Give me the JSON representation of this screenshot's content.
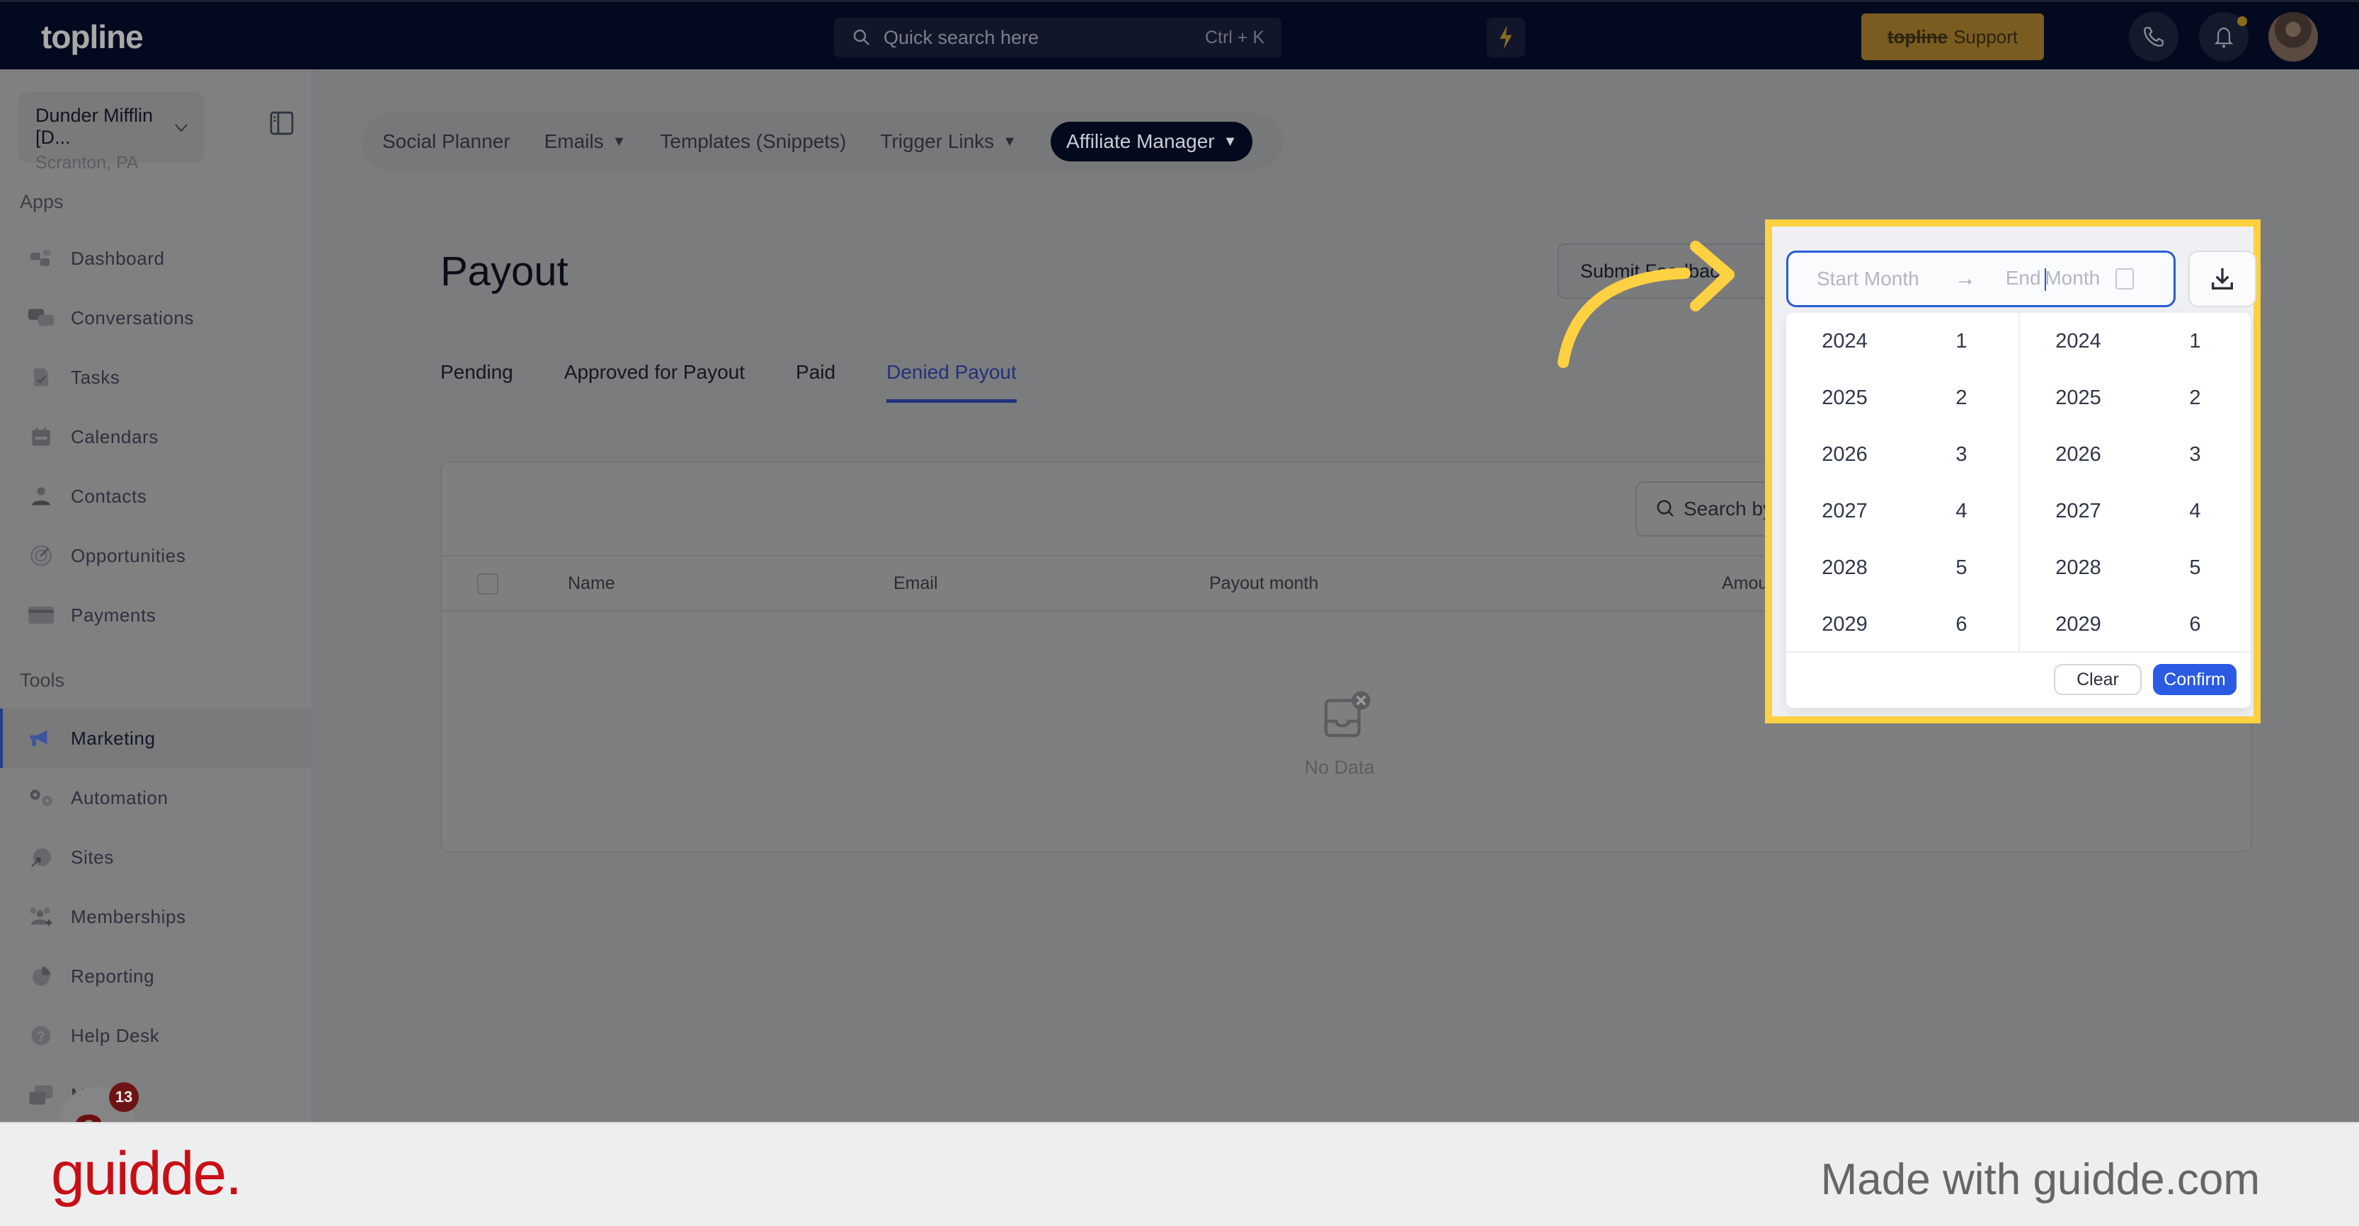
{
  "header": {
    "logo": "topline",
    "search_placeholder": "Quick search here",
    "search_shortcut": "Ctrl + K",
    "support_brand": "topline",
    "support_label": "Support"
  },
  "sidebar": {
    "location_name": "Dunder Mifflin [D...",
    "location_sub": "Scranton, PA",
    "apps_label": "Apps",
    "apps": [
      {
        "label": "Dashboard",
        "icon": "dashboard-icon"
      },
      {
        "label": "Conversations",
        "icon": "conversations-icon"
      },
      {
        "label": "Tasks",
        "icon": "tasks-icon"
      },
      {
        "label": "Calendars",
        "icon": "calendar-icon"
      },
      {
        "label": "Contacts",
        "icon": "contacts-icon"
      },
      {
        "label": "Opportunities",
        "icon": "target-icon"
      },
      {
        "label": "Payments",
        "icon": "credit-card-icon"
      }
    ],
    "tools_label": "Tools",
    "tools": [
      {
        "label": "Marketing",
        "icon": "megaphone-icon",
        "active": true
      },
      {
        "label": "Automation",
        "icon": "gears-icon"
      },
      {
        "label": "Sites",
        "icon": "globe-cursor-icon"
      },
      {
        "label": "Memberships",
        "icon": "users-plus-icon"
      },
      {
        "label": "Reporting",
        "icon": "pie-chart-icon"
      },
      {
        "label": "Help Desk",
        "icon": "help-icon"
      },
      {
        "label": "Mailgun",
        "icon": "mail-icon"
      }
    ],
    "notification_count": "13"
  },
  "marketing_nav": {
    "items": [
      {
        "label": "Social Planner",
        "dropdown": false
      },
      {
        "label": "Emails",
        "dropdown": true
      },
      {
        "label": "Templates (Snippets)",
        "dropdown": false
      },
      {
        "label": "Trigger Links",
        "dropdown": true
      },
      {
        "label": "Affiliate Manager",
        "dropdown": true,
        "active": true
      }
    ]
  },
  "page": {
    "title": "Payout",
    "feedback_button": "Submit Feedback",
    "tabs": [
      {
        "label": "Pending"
      },
      {
        "label": "Approved for Payout"
      },
      {
        "label": "Paid"
      },
      {
        "label": "Denied Payout",
        "active": true
      }
    ],
    "search_placeholder": "Search by",
    "columns": [
      "Name",
      "Email",
      "Payout month",
      "Amount"
    ],
    "empty_text": "No Data"
  },
  "month_picker": {
    "start_placeholder": "Start Month",
    "end_placeholder_a": "End ",
    "end_placeholder_b": "Month",
    "start": {
      "years": [
        "2024",
        "2025",
        "2026",
        "2027",
        "2028",
        "2029"
      ],
      "months": [
        "1",
        "2",
        "3",
        "4",
        "5",
        "6"
      ]
    },
    "end": {
      "years": [
        "2024",
        "2025",
        "2026",
        "2027",
        "2028",
        "2029"
      ],
      "months": [
        "1",
        "2",
        "3",
        "4",
        "5",
        "6"
      ]
    },
    "clear_label": "Clear",
    "confirm_label": "Confirm"
  },
  "colors": {
    "accent": "#2a5be2",
    "highlight": "#fdd141",
    "header_bg": "#030a1f"
  },
  "footer": {
    "logo": "guidde.",
    "tagline": "Made with guidde.com"
  }
}
